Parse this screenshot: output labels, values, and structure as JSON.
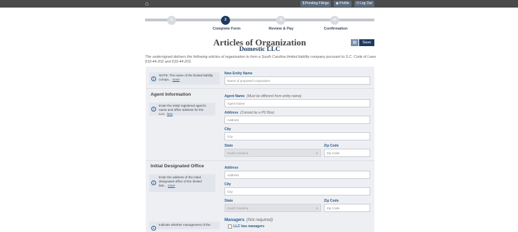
{
  "topbar": {
    "home_icon": "home-icon",
    "pending_filings": "Pending Filings",
    "profile": "Profile",
    "logout": "Log Out"
  },
  "steps": [
    {
      "number": "1",
      "label": ""
    },
    {
      "number": "2",
      "label": "Complete Form"
    },
    {
      "number": "3",
      "label": "Review & Pay"
    },
    {
      "number": "4",
      "label": "Confirmation"
    }
  ],
  "header": {
    "title": "Articles of Organization",
    "subtitle": "Domestic LLC",
    "save_label": "Save",
    "intro": "The undersigned delivers the following articles of organization to form a South Carolina limited liability company pursuant to S.C. Code of Laws §33-44-202 and §33-44-203."
  },
  "entity": {
    "info": "NOTE: The name of the limited liability compa...",
    "info_more": "more",
    "label": "New Entity Name",
    "placeholder": "Name of proposed corporation"
  },
  "agent": {
    "heading": "Agent Information",
    "info": "Enter the initial registered agent's name and office address for the LLC.",
    "info_less": "less",
    "name_label": "Agent Name",
    "name_hint": "(Must be different from entity name)",
    "name_placeholder": "Agent Name",
    "address_label": "Address",
    "address_hint": "(Cannot be a PO Box)",
    "address_placeholder": "Address",
    "city_label": "City",
    "city_placeholder": "City",
    "state_label": "State",
    "state_value": "South Carolina",
    "zip_label": "Zip Code",
    "zip_placeholder": "Zip Code"
  },
  "office": {
    "heading": "Initial Designated Office",
    "info": "Enter the address of the initial designated office of the limited liab...",
    "info_more": "more",
    "address_label": "Address",
    "address_placeholder": "Address",
    "city_label": "City",
    "city_placeholder": "City",
    "state_label": "State",
    "state_value": "South Carolina",
    "zip_label": "Zip Code",
    "zip_placeholder": "Zip Code"
  },
  "managers": {
    "info": "Indicate whether management of the",
    "label": "Managers",
    "hint": "(Not required)",
    "checkbox_label": "LLC has managers"
  }
}
